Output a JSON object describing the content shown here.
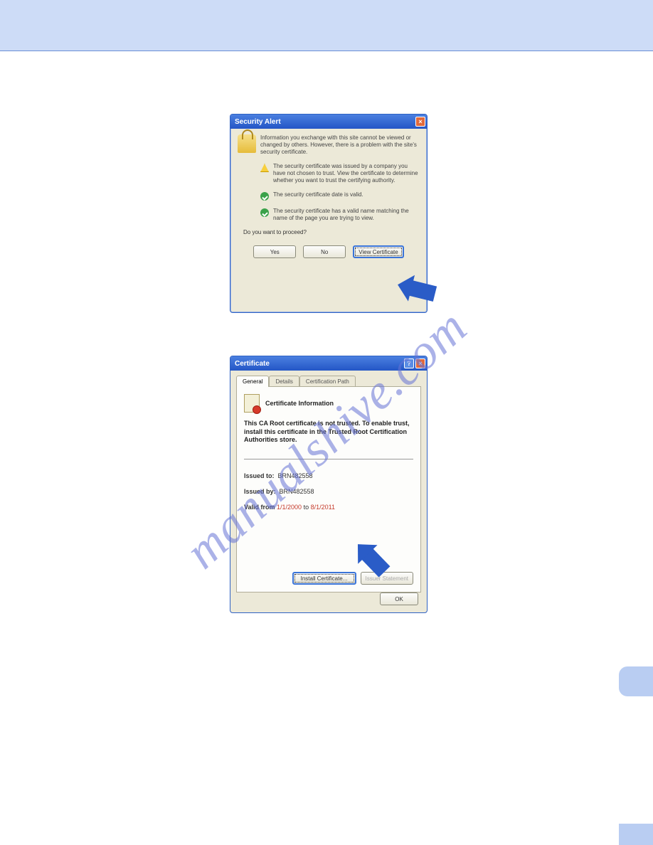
{
  "securityAlert": {
    "title": "Security Alert",
    "intro": "Information you exchange with this site cannot be viewed or changed by others. However, there is a problem with the site's security certificate.",
    "item1": "The security certificate was issued by a company you have not chosen to trust. View the certificate to determine whether you want to trust the certifying authority.",
    "item2": "The security certificate date is valid.",
    "item3": "The security certificate has a valid name matching the name of the page you are trying to view.",
    "proceed": "Do you want to proceed?",
    "yes": "Yes",
    "no": "No",
    "view": "View Certificate"
  },
  "certificate": {
    "title": "Certificate",
    "tabGeneral": "General",
    "tabDetails": "Details",
    "tabPath": "Certification Path",
    "heading": "Certificate Information",
    "msg": "This CA Root certificate is not trusted. To enable trust, install this certificate in the Trusted Root Certification Authorities store.",
    "issuedToLabel": "Issued to:",
    "issuedTo": "BRN482558",
    "issuedByLabel": "Issued by:",
    "issuedBy": "BRN482558",
    "validLabel": "Valid from",
    "validFrom": "1/1/2000",
    "validTo": "to",
    "validToDate": "8/1/2011",
    "install": "Install Certificate...",
    "issuer": "Issuer Statement",
    "ok": "OK"
  },
  "watermark": "manualshive.com"
}
